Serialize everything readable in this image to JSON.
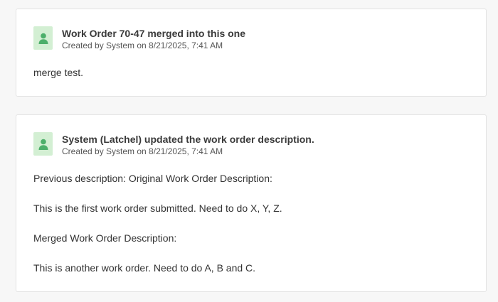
{
  "colors": {
    "avatar_bg": "#d3efd3",
    "avatar_fg": "#4caf6a",
    "card_border": "#e3e3e3",
    "page_bg": "#f7f7f7"
  },
  "entries": [
    {
      "icon": "user-icon",
      "title": "Work Order 70-47 merged into this one",
      "meta": "Created by System on 8/21/2025, 7:41 AM",
      "body": [
        "merge test."
      ]
    },
    {
      "icon": "user-icon",
      "title": "System (Latchel) updated the work order description.",
      "meta": "Created by System on 8/21/2025, 7:41 AM",
      "body": [
        "Previous description: Original Work Order Description:",
        "This is the first work order submitted. Need to do X, Y, Z.",
        "Merged Work Order Description:",
        "This is another work order. Need to do A, B and C."
      ]
    }
  ]
}
